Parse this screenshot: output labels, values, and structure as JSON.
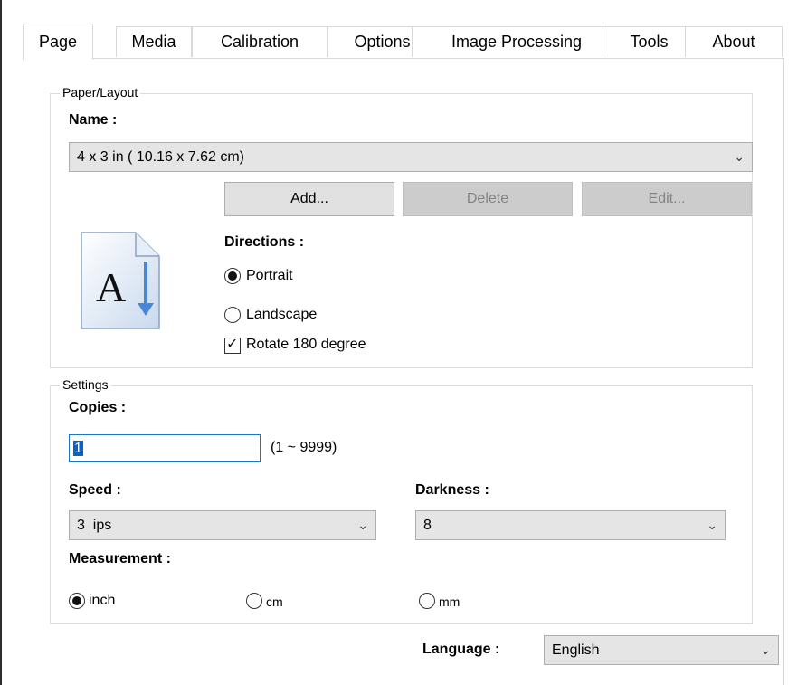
{
  "tabs": [
    {
      "label": "Page",
      "active": true
    },
    {
      "label": "Media"
    },
    {
      "label": "Calibration"
    },
    {
      "label": "Options"
    },
    {
      "label": "Image Processing"
    },
    {
      "label": "Tools"
    },
    {
      "label": "About"
    }
  ],
  "paper_layout": {
    "legend": "Paper/Layout",
    "name_label": "Name :",
    "name_value": "4 x 3 in ( 10.16 x 7.62 cm)",
    "add_button": "Add...",
    "delete_button": "Delete",
    "edit_button": "Edit...",
    "directions_label": "Directions :",
    "portrait_label": "Portrait",
    "landscape_label": "Landscape",
    "rotate_label": "Rotate 180 degree",
    "orientation": "Portrait",
    "rotate_checked": true,
    "page_icon": "page-portrait-icon"
  },
  "settings": {
    "legend": "Settings",
    "copies_label": "Copies :",
    "copies_value": "1",
    "copies_range": "(1 ~ 9999)",
    "speed_label": "Speed :",
    "speed_value": "3  ips",
    "darkness_label": "Darkness :",
    "darkness_value": "8",
    "measurement_label": "Measurement :",
    "inch_label": "inch",
    "cm_label": "cm",
    "mm_label": "mm",
    "measurement_selected": "inch"
  },
  "language": {
    "label": "Language :",
    "value": "English"
  },
  "colors": {
    "accent": "#0a64c8",
    "icon_arrow": "#4a86d8"
  }
}
